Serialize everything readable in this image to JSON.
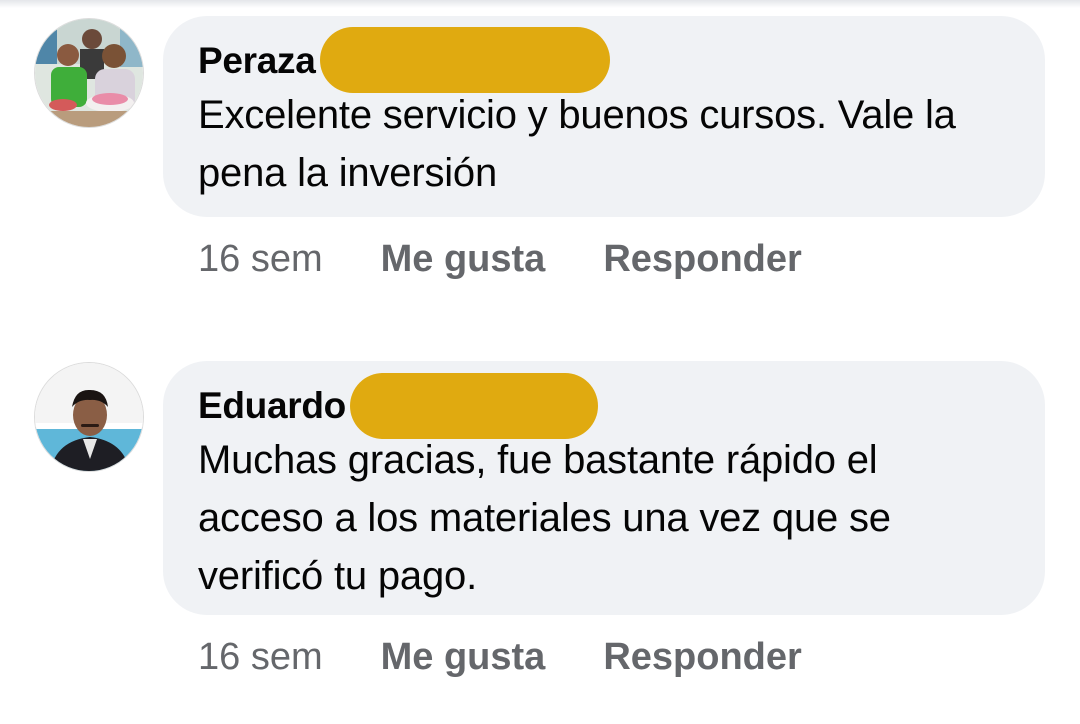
{
  "colors": {
    "bubble_bg": "#f0f2f5",
    "meta_text": "#65676b",
    "redaction": "#e0aa10"
  },
  "comments": [
    {
      "author": "Peraza",
      "text": "Excelente servicio y buenos cursos. Vale la pena la inversión",
      "timestamp": "16 sem",
      "like_label": "Me gusta",
      "reply_label": "Responder"
    },
    {
      "author": "Eduardo",
      "text": "Muchas gracias, fue bastante rápido el acceso a los materiales una vez que se verificó tu pago.",
      "timestamp": "16 sem",
      "like_label": "Me gusta",
      "reply_label": "Responder"
    }
  ]
}
